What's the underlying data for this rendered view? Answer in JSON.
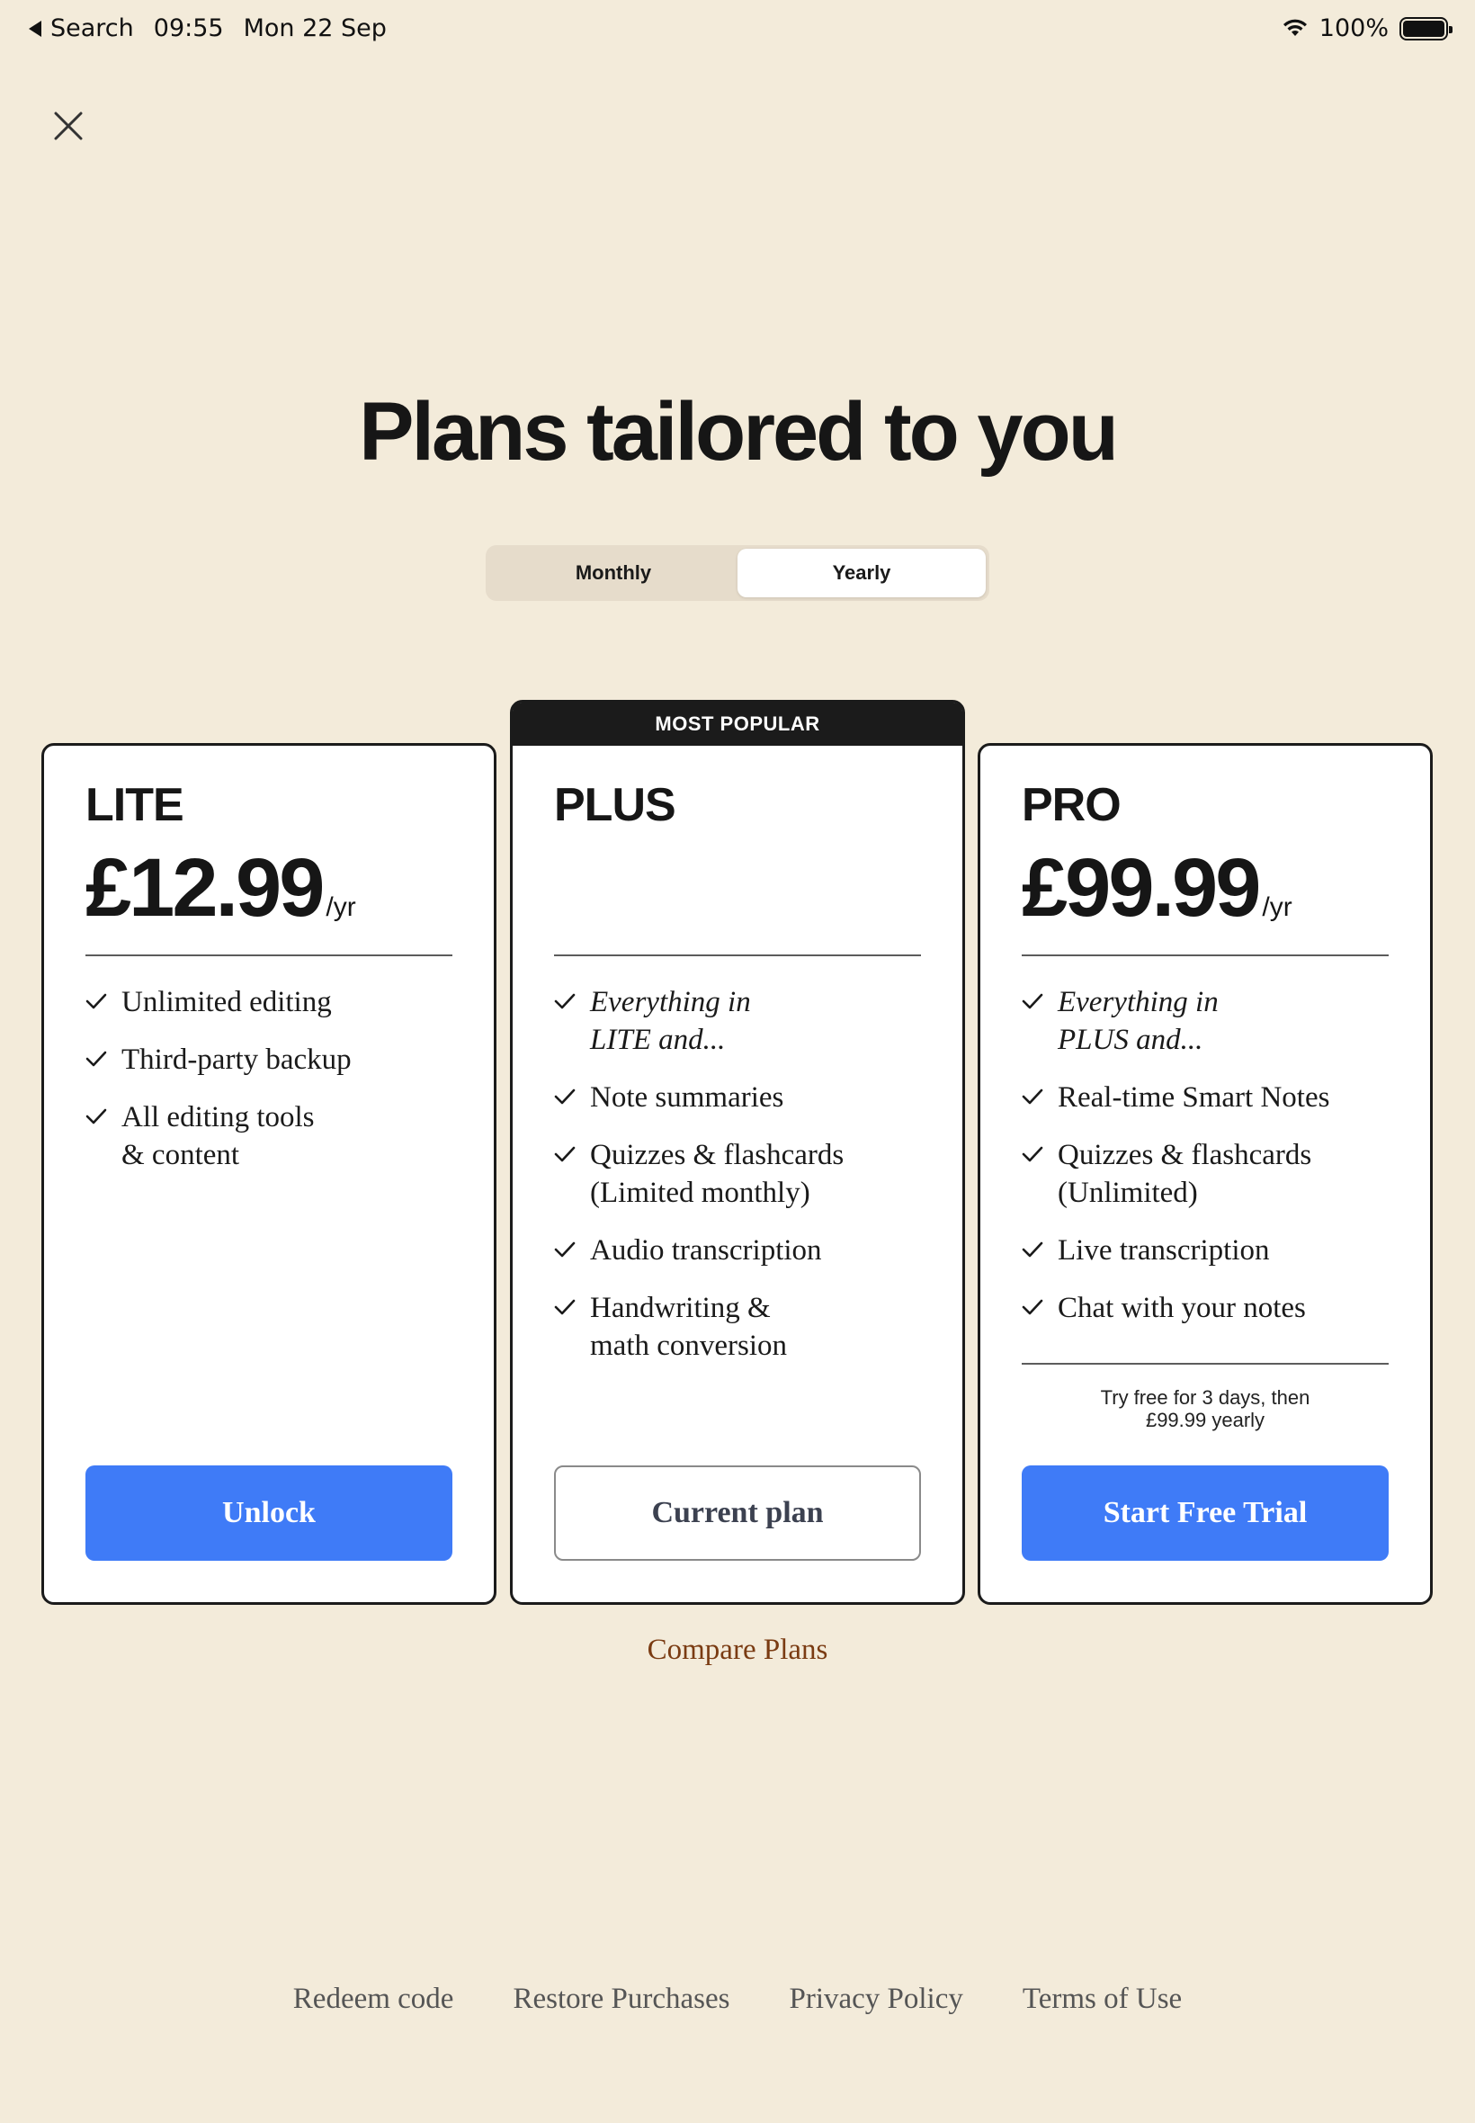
{
  "status_bar": {
    "back_label": "Search",
    "time": "09:55",
    "date": "Mon 22 Sep",
    "battery": "100%"
  },
  "page": {
    "title": "Plans tailored to you"
  },
  "billing_toggle": {
    "options": [
      "Monthly",
      "Yearly"
    ],
    "selected": "Yearly"
  },
  "plans": [
    {
      "name": "LITE",
      "price": "£12.99",
      "period": "/yr",
      "features": [
        {
          "text": "Unlimited editing",
          "italic": false
        },
        {
          "text": "Third-party backup",
          "italic": false
        },
        {
          "text": "All editing tools\n& content",
          "italic": false
        }
      ],
      "button": "Unlock"
    },
    {
      "name": "PLUS",
      "badge": "MOST POPULAR",
      "features": [
        {
          "text": "Everything in\nLITE and...",
          "italic": true
        },
        {
          "text": "Note summaries",
          "italic": false
        },
        {
          "text": "Quizzes & flashcards\n(Limited monthly)",
          "italic": false
        },
        {
          "text": "Audio transcription",
          "italic": false
        },
        {
          "text": "Handwriting &\nmath conversion",
          "italic": false
        }
      ],
      "button": "Current plan"
    },
    {
      "name": "PRO",
      "price": "£99.99",
      "period": "/yr",
      "features": [
        {
          "text": "Everything in\nPLUS and...",
          "italic": true
        },
        {
          "text": "Real-time Smart Notes",
          "italic": false
        },
        {
          "text": "Quizzes & flashcards\n(Unlimited)",
          "italic": false
        },
        {
          "text": "Live transcription",
          "italic": false
        },
        {
          "text": "Chat with your notes",
          "italic": false
        }
      ],
      "trial_note": [
        "Try free for 3 days, then",
        "£99.99 yearly"
      ],
      "button": "Start Free Trial"
    }
  ],
  "compare_link": "Compare Plans",
  "footer": {
    "links": [
      "Redeem code",
      "Restore Purchases",
      "Privacy Policy",
      "Terms of Use"
    ]
  },
  "colors": {
    "background": "#f3ebda",
    "primary_button": "#3f7bf7",
    "link": "#7a3b12"
  }
}
